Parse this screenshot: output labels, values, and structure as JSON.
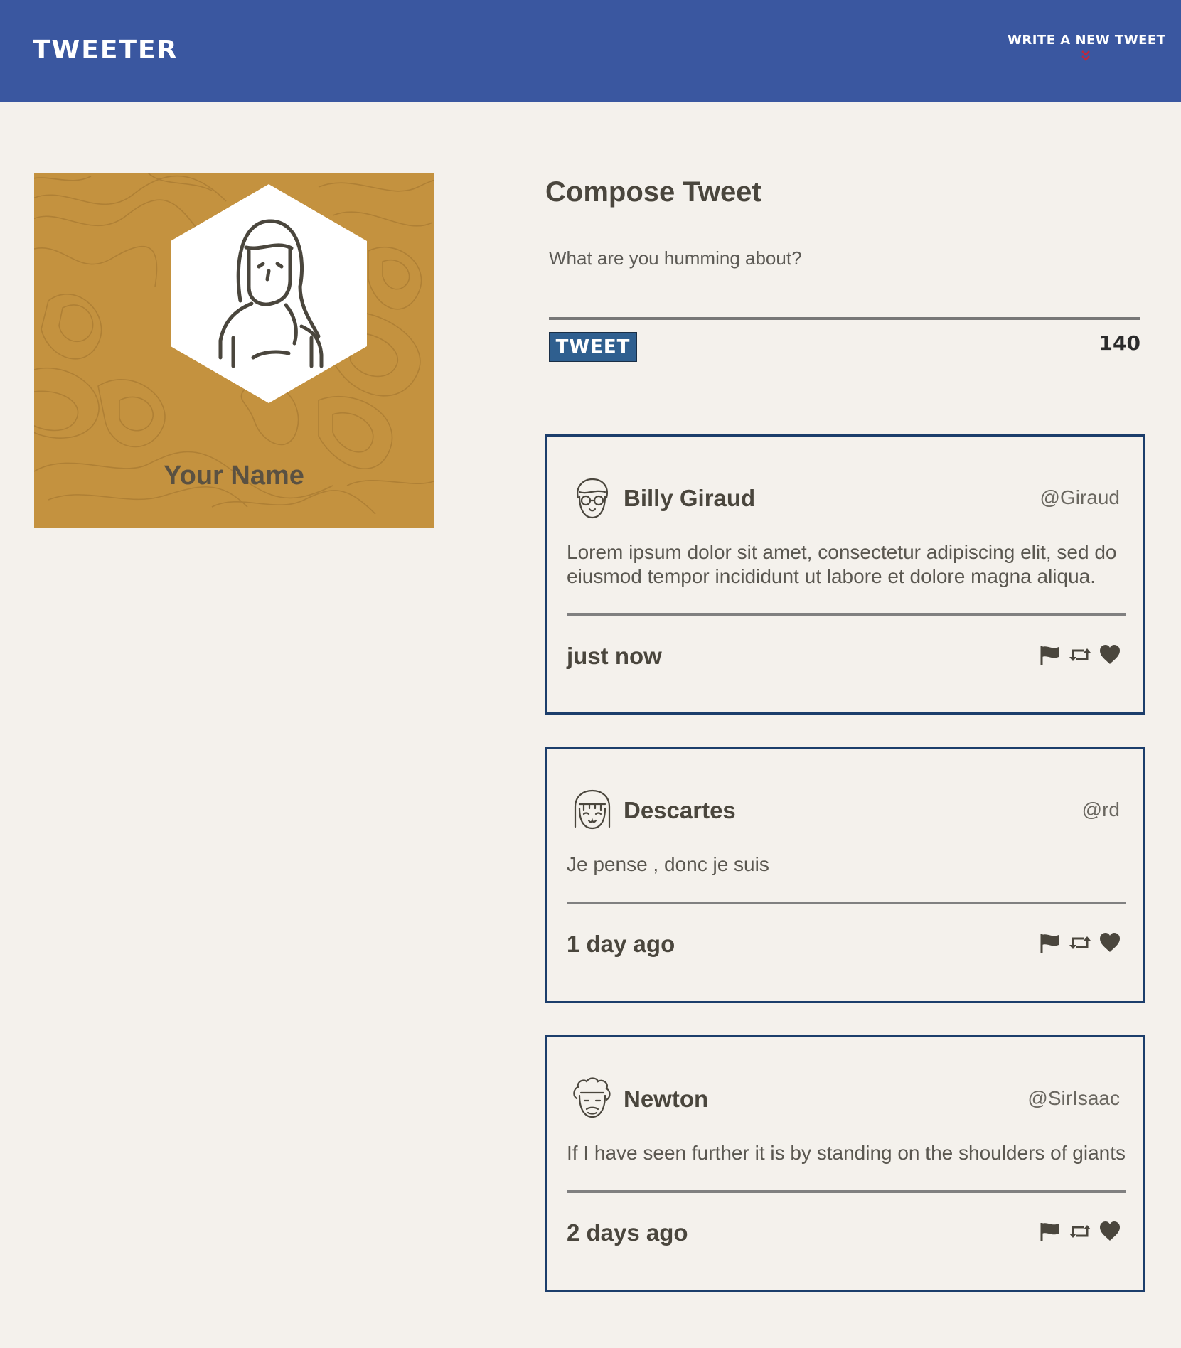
{
  "nav": {
    "brand": "TWEETER",
    "write_label": "WRITE A NEW TWEET"
  },
  "profile": {
    "name": "Your Name"
  },
  "compose": {
    "title": "Compose Tweet",
    "placeholder": "What are you humming about?",
    "button_label": "TWEET",
    "counter": "140"
  },
  "tweets": [
    {
      "name": "Billy Giraud",
      "handle": "@Giraud",
      "body": "Lorem ipsum dolor sit amet, consectetur adipiscing elit, sed do eiusmod tempor incididunt ut labore et dolore magna aliqua.",
      "time": "just now"
    },
    {
      "name": "Descartes",
      "handle": "@rd",
      "body": "Je pense , donc je suis",
      "time": "1 day ago"
    },
    {
      "name": "Newton",
      "handle": "@SirIsaac",
      "body": "If I have seen further it is by standing on the shoulders of giants",
      "time": "2 days ago"
    }
  ],
  "colors": {
    "nav_bg": "#3a57a0",
    "page_bg": "#f4f1ec",
    "profile_bg": "#c4923f",
    "tweet_border": "#1c3e6b",
    "button_bg": "#2f5f8f",
    "chevron": "#c0283c"
  },
  "icons": {
    "nav_chevron": "double-chevron-down-icon",
    "actions": [
      "flag-icon",
      "retweet-icon",
      "heart-icon"
    ]
  }
}
